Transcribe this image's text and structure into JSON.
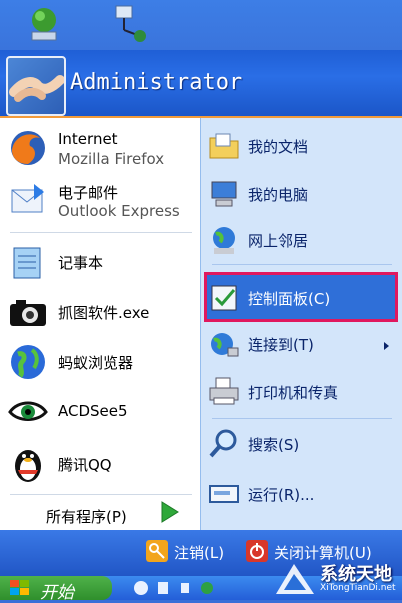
{
  "user": {
    "name": "Administrator"
  },
  "left_items": [
    {
      "title": "Internet",
      "subtitle": "Mozilla Firefox",
      "icon": "firefox-icon"
    },
    {
      "title": "电子邮件",
      "subtitle": "Outlook Express",
      "icon": "outlook-icon"
    },
    {
      "title": "记事本",
      "icon": "notepad-icon"
    },
    {
      "title": "抓图软件.exe",
      "icon": "camera-icon"
    },
    {
      "title": "蚂蚁浏览器",
      "icon": "globe-icon"
    },
    {
      "title": "ACDSee5",
      "icon": "eye-icon"
    },
    {
      "title": "腾讯QQ",
      "icon": "qq-penguin-icon"
    }
  ],
  "all_programs": "所有程序(P)",
  "right_items": [
    {
      "label": "我的文档",
      "icon": "documents-folder-icon"
    },
    {
      "label": "我的电脑",
      "icon": "computer-icon"
    },
    {
      "label": "网上邻居",
      "icon": "network-icon"
    },
    {
      "label": "控制面板(C)",
      "icon": "control-panel-icon"
    },
    {
      "label": "连接到(T)",
      "icon": "connect-icon"
    },
    {
      "label": "打印机和传真",
      "icon": "printer-icon"
    },
    {
      "label": "搜索(S)",
      "icon": "search-icon"
    },
    {
      "label": "运行(R)...",
      "icon": "run-icon"
    }
  ],
  "footer": {
    "logoff": "注销(L)",
    "shutdown": "关闭计算机(U)"
  },
  "taskbar": {
    "start": "开始"
  },
  "watermark": {
    "name": "系统天地",
    "url": "XiTongTianDi.net"
  },
  "colors": {
    "highlight_border": "#e0185e",
    "menu_blue": "#2156c6",
    "start_green": "#3a9f36"
  }
}
